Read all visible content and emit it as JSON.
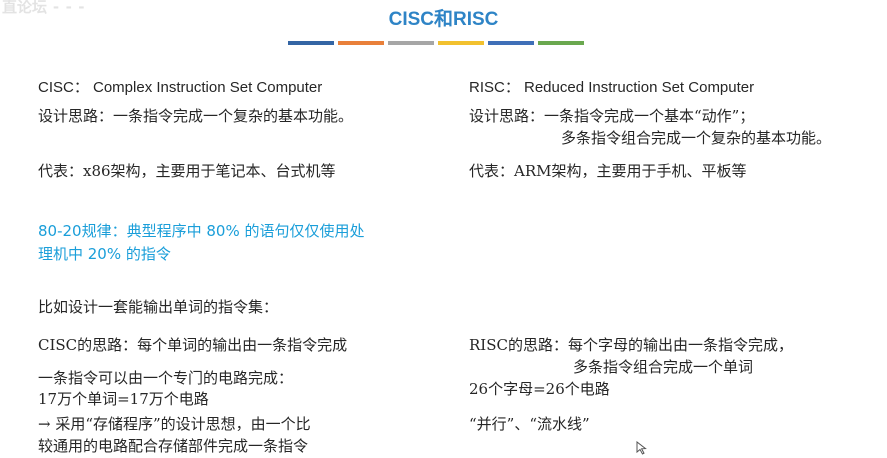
{
  "watermark": "直论坛  ⁃ ⁃ ⁃",
  "title": "CISC和RISC",
  "bar_colors": [
    "#3465a4",
    "#e9803a",
    "#a6a6a6",
    "#f2c12e",
    "#3f6fb8",
    "#6aa84f"
  ],
  "left": {
    "def": "CISC： Complex Instruction Set Computer",
    "idea": "设计思路：一条指令完成一个复杂的基本功能。",
    "rep": "代表：x86架构，主要用于笔记本、台式机等",
    "rule_line1": "80-20规律：典型程序中 80% 的语句仅仅使用处",
    "rule_line2": "理机中 20% 的指令",
    "example": "比如设计一套能输出单词的指令集：",
    "approach": "CISC的思路：每个单词的输出由一条指令完成",
    "circuit": "一条指令可以由一个专门的电路完成：",
    "count": "17万个单词=17万个电路",
    "storage_line1": "→ 采用“存储程序”的设计思想，由一个比",
    "storage_line2": "较通用的电路配合存储部件完成一条指令"
  },
  "right": {
    "def": "RISC： Reduced Instruction Set Computer",
    "idea_line1": "设计思路：一条指令完成一个基本“动作”；",
    "idea_line2": "多条指令组合完成一个复杂的基本功能。",
    "rep": "代表：ARM架构，主要用于手机、平板等",
    "approach_line1": "RISC的思路：每个字母的输出由一条指令完成，",
    "approach_line2": "多条指令组合完成一个单词",
    "count": "26个字母=26个电路",
    "parallel": "“并行”、“流水线”"
  }
}
